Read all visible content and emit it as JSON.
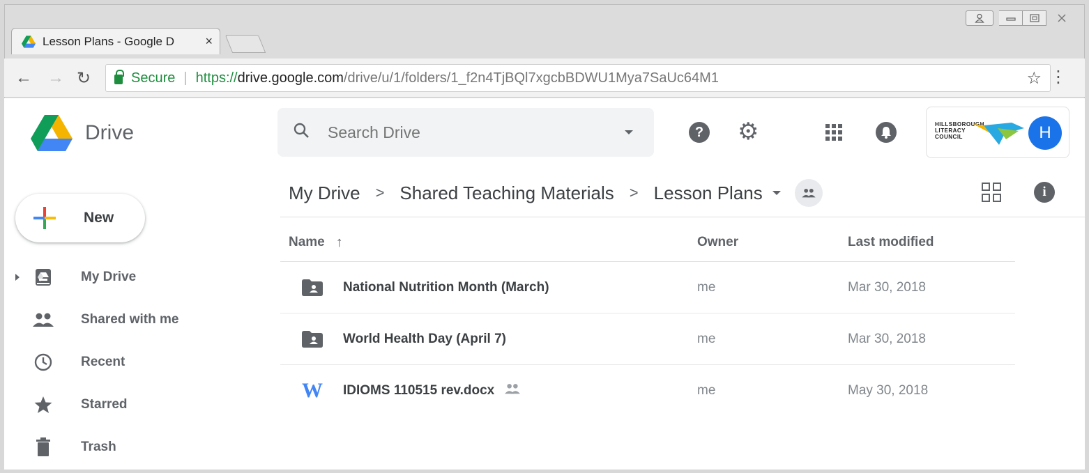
{
  "window": {
    "controls": [
      "user-icon",
      "minimize-icon",
      "maximize-icon",
      "close-icon"
    ]
  },
  "tab": {
    "title": "Lesson Plans - Google D",
    "close": "×"
  },
  "address_bar": {
    "secure_label": "Secure",
    "url_scheme": "https://",
    "url_host": "drive.google.com",
    "url_path": "/drive/u/1/folders/1_f2n4TjBQl7xgcbBDWU1Mya7SaUc64M1"
  },
  "app": {
    "name": "Drive",
    "search_placeholder": "Search Drive",
    "avatar_initial": "H",
    "org_logo_lines": [
      "Hillsborough",
      "Literacy",
      "Council"
    ]
  },
  "new_button": {
    "label": "New"
  },
  "nav": [
    {
      "label": "My Drive",
      "icon": "my-drive-icon"
    },
    {
      "label": "Shared with me",
      "icon": "people-icon"
    },
    {
      "label": "Recent",
      "icon": "clock-icon"
    },
    {
      "label": "Starred",
      "icon": "star-icon"
    },
    {
      "label": "Trash",
      "icon": "trash-icon"
    }
  ],
  "breadcrumb": [
    "My Drive",
    "Shared Teaching Materials",
    "Lesson Plans"
  ],
  "list": {
    "headers": {
      "name": "Name",
      "owner": "Owner",
      "modified": "Last modified"
    },
    "rows": [
      {
        "name": "National Nutrition Month (March)",
        "owner": "me",
        "modified": "Mar 30, 2018",
        "type": "shared-folder"
      },
      {
        "name": "World Health Day (April 7)",
        "owner": "me",
        "modified": "Mar 30, 2018",
        "type": "shared-folder"
      },
      {
        "name": "IDIOMS 110515 rev.docx",
        "owner": "me",
        "modified": "May 30, 2018",
        "type": "word-doc",
        "shared": true
      }
    ]
  },
  "colors": {
    "drive_green": "#0f9d58",
    "drive_yellow": "#f4b400",
    "drive_blue": "#4285f4",
    "avatar_blue": "#1a73e8",
    "secure_green": "#1e8e3e"
  }
}
